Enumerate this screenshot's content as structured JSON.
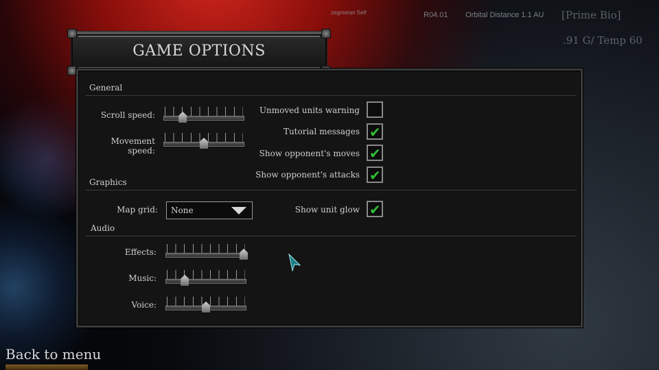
{
  "hud": {
    "tiny_label": "zegmeran Self",
    "code": "R04.01",
    "orbital_distance": "Orbital Distance 1.1 AU",
    "planet_bio": "[Prime Bio]",
    "gravity_temp": ".91 G/ Temp 60"
  },
  "title": "GAME OPTIONS",
  "sections": {
    "general": "General",
    "graphics": "Graphics",
    "audio": "Audio"
  },
  "general": {
    "scroll_speed_label": "Scroll speed:",
    "scroll_speed_value": 0.22,
    "movement_speed_label": "Movement speed:",
    "movement_speed_value": 0.5,
    "unmoved_units_warning": {
      "label": "Unmoved units warning",
      "checked": false
    },
    "tutorial_messages": {
      "label": "Tutorial messages",
      "checked": true
    },
    "show_opponent_moves": {
      "label": "Show opponent's moves",
      "checked": true
    },
    "show_opponent_attacks": {
      "label": "Show opponent's attacks",
      "checked": true
    }
  },
  "graphics": {
    "map_grid_label": "Map grid:",
    "map_grid_value": "None",
    "show_unit_glow": {
      "label": "Show unit glow",
      "checked": true
    }
  },
  "audio": {
    "effects_label": "Effects:",
    "effects_value": 1.0,
    "music_label": "Music:",
    "music_value": 0.22,
    "voice_label": "Voice:",
    "voice_value": 0.5
  },
  "back_label": "Back to menu",
  "colors": {
    "check": "#2fbf34",
    "panel": "#141414"
  },
  "icons": {
    "check": "check-icon",
    "dropdown": "chevron-down-icon",
    "cursor": "pointer-cursor-icon"
  }
}
